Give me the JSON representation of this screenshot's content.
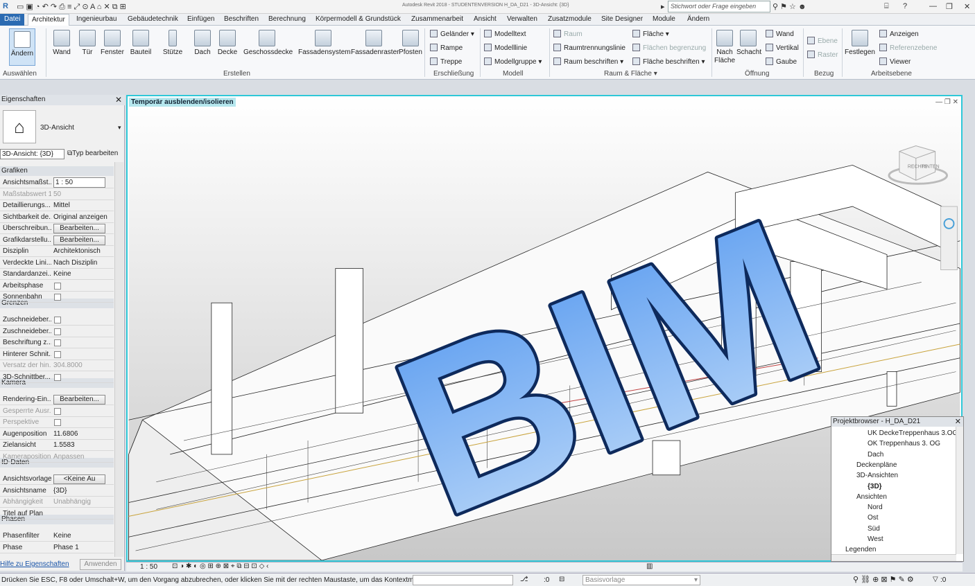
{
  "titlebar": {
    "app_title": "Autodesk Revit 2018 - STUDENTENVERSION    H_DA_D21 - 3D-Ansicht: {3D}",
    "search_placeholder": "Stichwort oder Frage eingeben"
  },
  "tabs": [
    "Datei",
    "Architektur",
    "Ingenieurbau",
    "Gebäudetechnik",
    "Einfügen",
    "Beschriften",
    "Berechnung",
    "Körpermodell & Grundstück",
    "Zusammenarbeit",
    "Ansicht",
    "Verwalten",
    "Zusatzmodule",
    "Site Designer",
    "Module",
    "Ändern"
  ],
  "ribbon": {
    "big": [
      "Ändern",
      "Wand",
      "Tür",
      "Fenster",
      "Bauteil",
      "Stütze",
      "Dach",
      "Decke",
      "Geschossdecke",
      "Fassadensystem",
      "Fassadenraster",
      "Pfosten"
    ],
    "small_a": [
      "Geländer",
      "Rampe",
      "Treppe"
    ],
    "small_b": [
      "Modelltext",
      "Modelllinie",
      "Modellgruppe"
    ],
    "small_c": [
      "Raum",
      "Raumtrennungslinie",
      "Raum  beschriften"
    ],
    "small_d": [
      "Fläche",
      "Flächen  begrenzung",
      "Fläche  beschriften"
    ],
    "opening_big": [
      "Nach Fläche",
      "Schacht"
    ],
    "opening_small": [
      "Wand",
      "Vertikal",
      "Gaube"
    ],
    "datum": [
      "Ebene",
      "Raster"
    ],
    "workplane_big": "Festlegen",
    "workplane_small": [
      "Anzeigen",
      "Referenzebene",
      "Viewer"
    ],
    "groups": [
      "Auswählen",
      "Erstellen",
      "Erschließung",
      "Modell",
      "Raum & Fläche",
      "Öffnung",
      "Bezug",
      "Arbeitsebene"
    ]
  },
  "properties": {
    "title": "Eigenschaften",
    "type": "3D-Ansicht",
    "instance": "3D-Ansicht: {3D}",
    "edit_type": "Typ bearbeiten",
    "sections": {
      "grafiken": "Grafiken",
      "grenzen": "Grenzen",
      "kamera": "Kamera",
      "daten": "ID-Daten",
      "phasen": "Phasen"
    },
    "rows": [
      [
        "Ansichtsmaßst...",
        "1 : 50"
      ],
      [
        "Maßstabswert 1:",
        "50"
      ],
      [
        "Detaillierungs...",
        "Mittel"
      ],
      [
        "Sichtbarkeit de...",
        "Original anzeigen"
      ],
      [
        "Überschreibun...",
        "Bearbeiten..."
      ],
      [
        "Grafikdarstellu...",
        "Bearbeiten..."
      ],
      [
        "Disziplin",
        "Architektonisch"
      ],
      [
        "Verdeckte Lini...",
        "Nach Disziplin"
      ],
      [
        "Standardanzei...",
        "Keine"
      ],
      [
        "Arbeitsphase",
        ""
      ],
      [
        "Sonnenbahn",
        ""
      ],
      [
        "Zuschneideber...",
        ""
      ],
      [
        "Zuschneideber...",
        ""
      ],
      [
        "Beschriftung z...",
        ""
      ],
      [
        "Hinterer Schnit...",
        ""
      ],
      [
        "Versatz der hin...",
        "304.8000"
      ],
      [
        "3D-Schnittber...",
        ""
      ],
      [
        "Rendering-Ein...",
        "Bearbeiten..."
      ],
      [
        "Gesperrte Ausr...",
        ""
      ],
      [
        "Perspektive",
        ""
      ],
      [
        "Augenposition",
        "11.6806"
      ],
      [
        "Zielansicht",
        "1.5583"
      ],
      [
        "Kameraposition",
        "Anpassen"
      ],
      [
        "Ansichtsvorlage",
        "<Keine Au"
      ],
      [
        "Ansichtsname",
        "{3D}"
      ],
      [
        "Abhängigkeit",
        "Unabhängig"
      ],
      [
        "Titel auf Plan",
        ""
      ],
      [
        "Phasenfilter",
        "Keine"
      ],
      [
        "Phase",
        "Phase 1"
      ]
    ],
    "help": "Hilfe zu Eigenschaften",
    "apply": "Anwenden"
  },
  "view": {
    "isolate_label": "Temporär ausblenden/isolieren",
    "overlay_text": "BIM",
    "viewcube_right": "RECHTS",
    "viewcube_back": "HINTEN",
    "scale": "1 : 50"
  },
  "project_browser": {
    "title": "Projektbrowser - H_DA_D21",
    "items": [
      "UK DeckeTreppenhaus 3.OG",
      "OK Treppenhaus 3. OG",
      "Dach",
      "Deckenpläne",
      "3D-Ansichten",
      "{3D}",
      "Ansichten",
      "Nord",
      "Ost",
      "Süd",
      "West",
      "Legenden"
    ]
  },
  "status": {
    "message": "Drücken Sie ESC, F8 oder Umschalt+W, um den Vorgang abzubrechen, oder klicken Sie mit der rechten Maustaste, um das Kontextm",
    "worksets": ":0",
    "template": "Basisvorlage",
    "filter": ":0"
  },
  "colors": {
    "accent": "#2ec8d8",
    "file_tab": "#2b6bb2",
    "bim_fill_top": "#5b9cf0",
    "bim_fill_bottom": "#b8d6f8",
    "bim_stroke": "#0e2a5c"
  }
}
